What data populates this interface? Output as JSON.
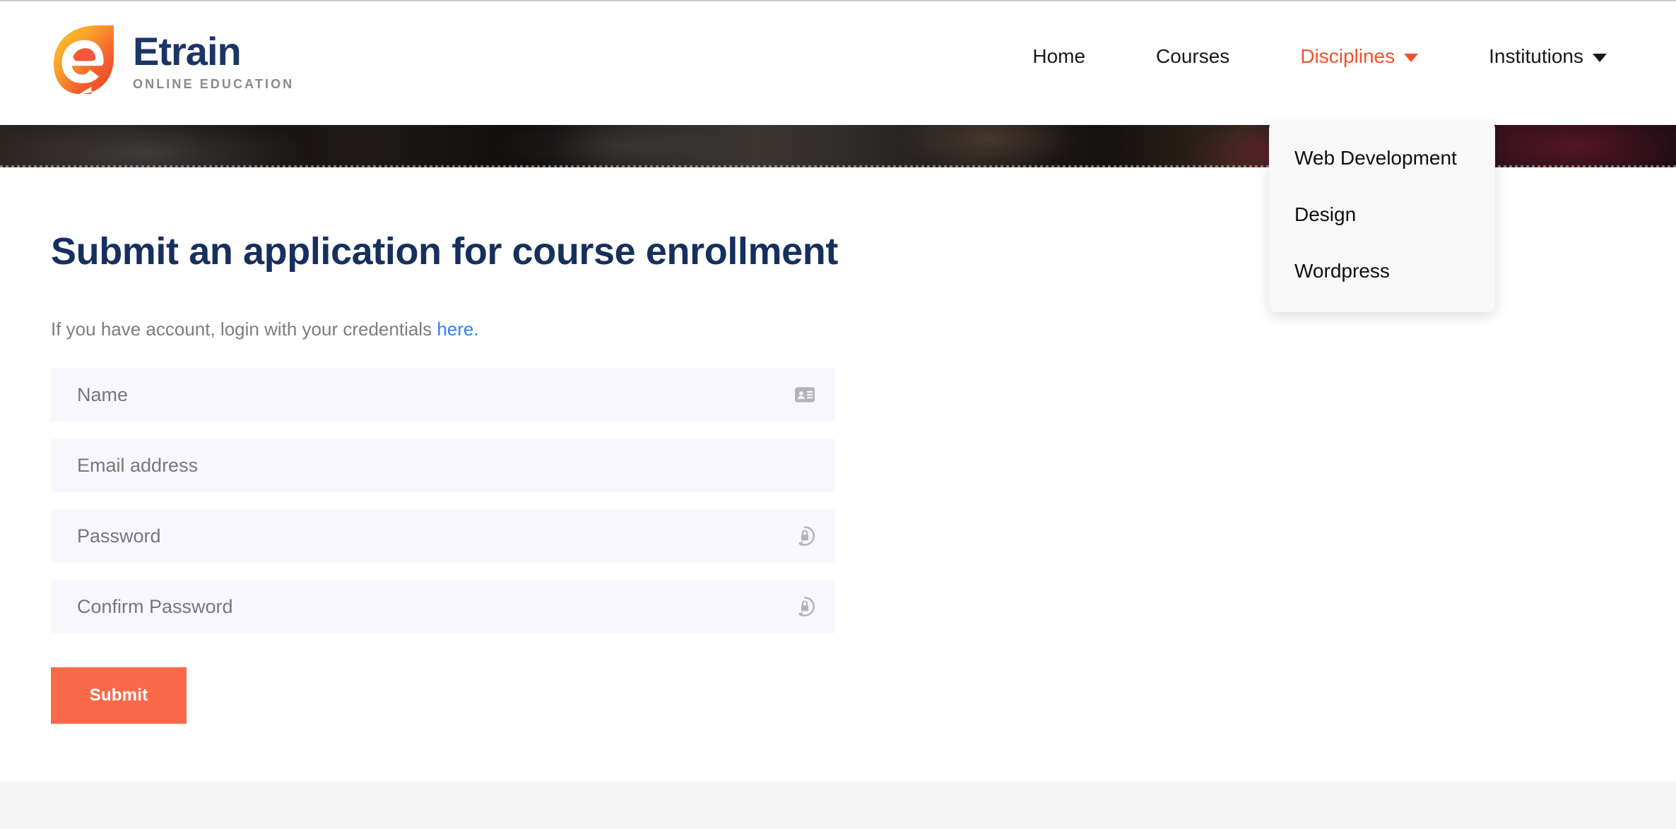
{
  "brand": {
    "name": "Etrain",
    "tagline": "ONLINE EDUCATION",
    "logo_icon": "etrain-leaf-e-logo",
    "name_color": "#1b3566",
    "tagline_color": "#8a8a8a",
    "accent_gradient_from": "#f9b233",
    "accent_gradient_to": "#ee3e23"
  },
  "nav": {
    "items": [
      {
        "label": "Home",
        "has_caret": false,
        "active": false
      },
      {
        "label": "Courses",
        "has_caret": false,
        "active": false
      },
      {
        "label": "Disciplines",
        "has_caret": true,
        "active": true
      },
      {
        "label": "Institutions",
        "has_caret": true,
        "active": false
      }
    ],
    "active_color": "#f4502a",
    "default_color": "#16181c"
  },
  "dropdown": {
    "open_for": "Disciplines",
    "background": "#f8f8f8",
    "items": [
      {
        "label": "Web Development"
      },
      {
        "label": "Design"
      },
      {
        "label": "Wordpress"
      }
    ]
  },
  "main": {
    "title": "Submit an application for course enrollment",
    "title_color": "#16305e",
    "subtext_prefix": "If you have account, login with your credentials ",
    "subtext_link": "here.",
    "link_color": "#2f7fff"
  },
  "form": {
    "fields": [
      {
        "name": "name",
        "placeholder": "Name",
        "value": "",
        "type": "text",
        "icon": "contact-card-icon"
      },
      {
        "name": "email",
        "placeholder": "Email address",
        "value": "",
        "type": "text",
        "icon": ""
      },
      {
        "name": "password",
        "placeholder": "Password",
        "value": "",
        "type": "password",
        "icon": "lock-rotate-icon"
      },
      {
        "name": "confirm_password",
        "placeholder": "Confirm Password",
        "value": "",
        "type": "password",
        "icon": "lock-rotate-icon"
      }
    ],
    "field_background": "#f8f7fd",
    "submit_label": "Submit",
    "submit_color": "#fa6a4a"
  },
  "footer": {
    "background": "#f5f5f6"
  }
}
